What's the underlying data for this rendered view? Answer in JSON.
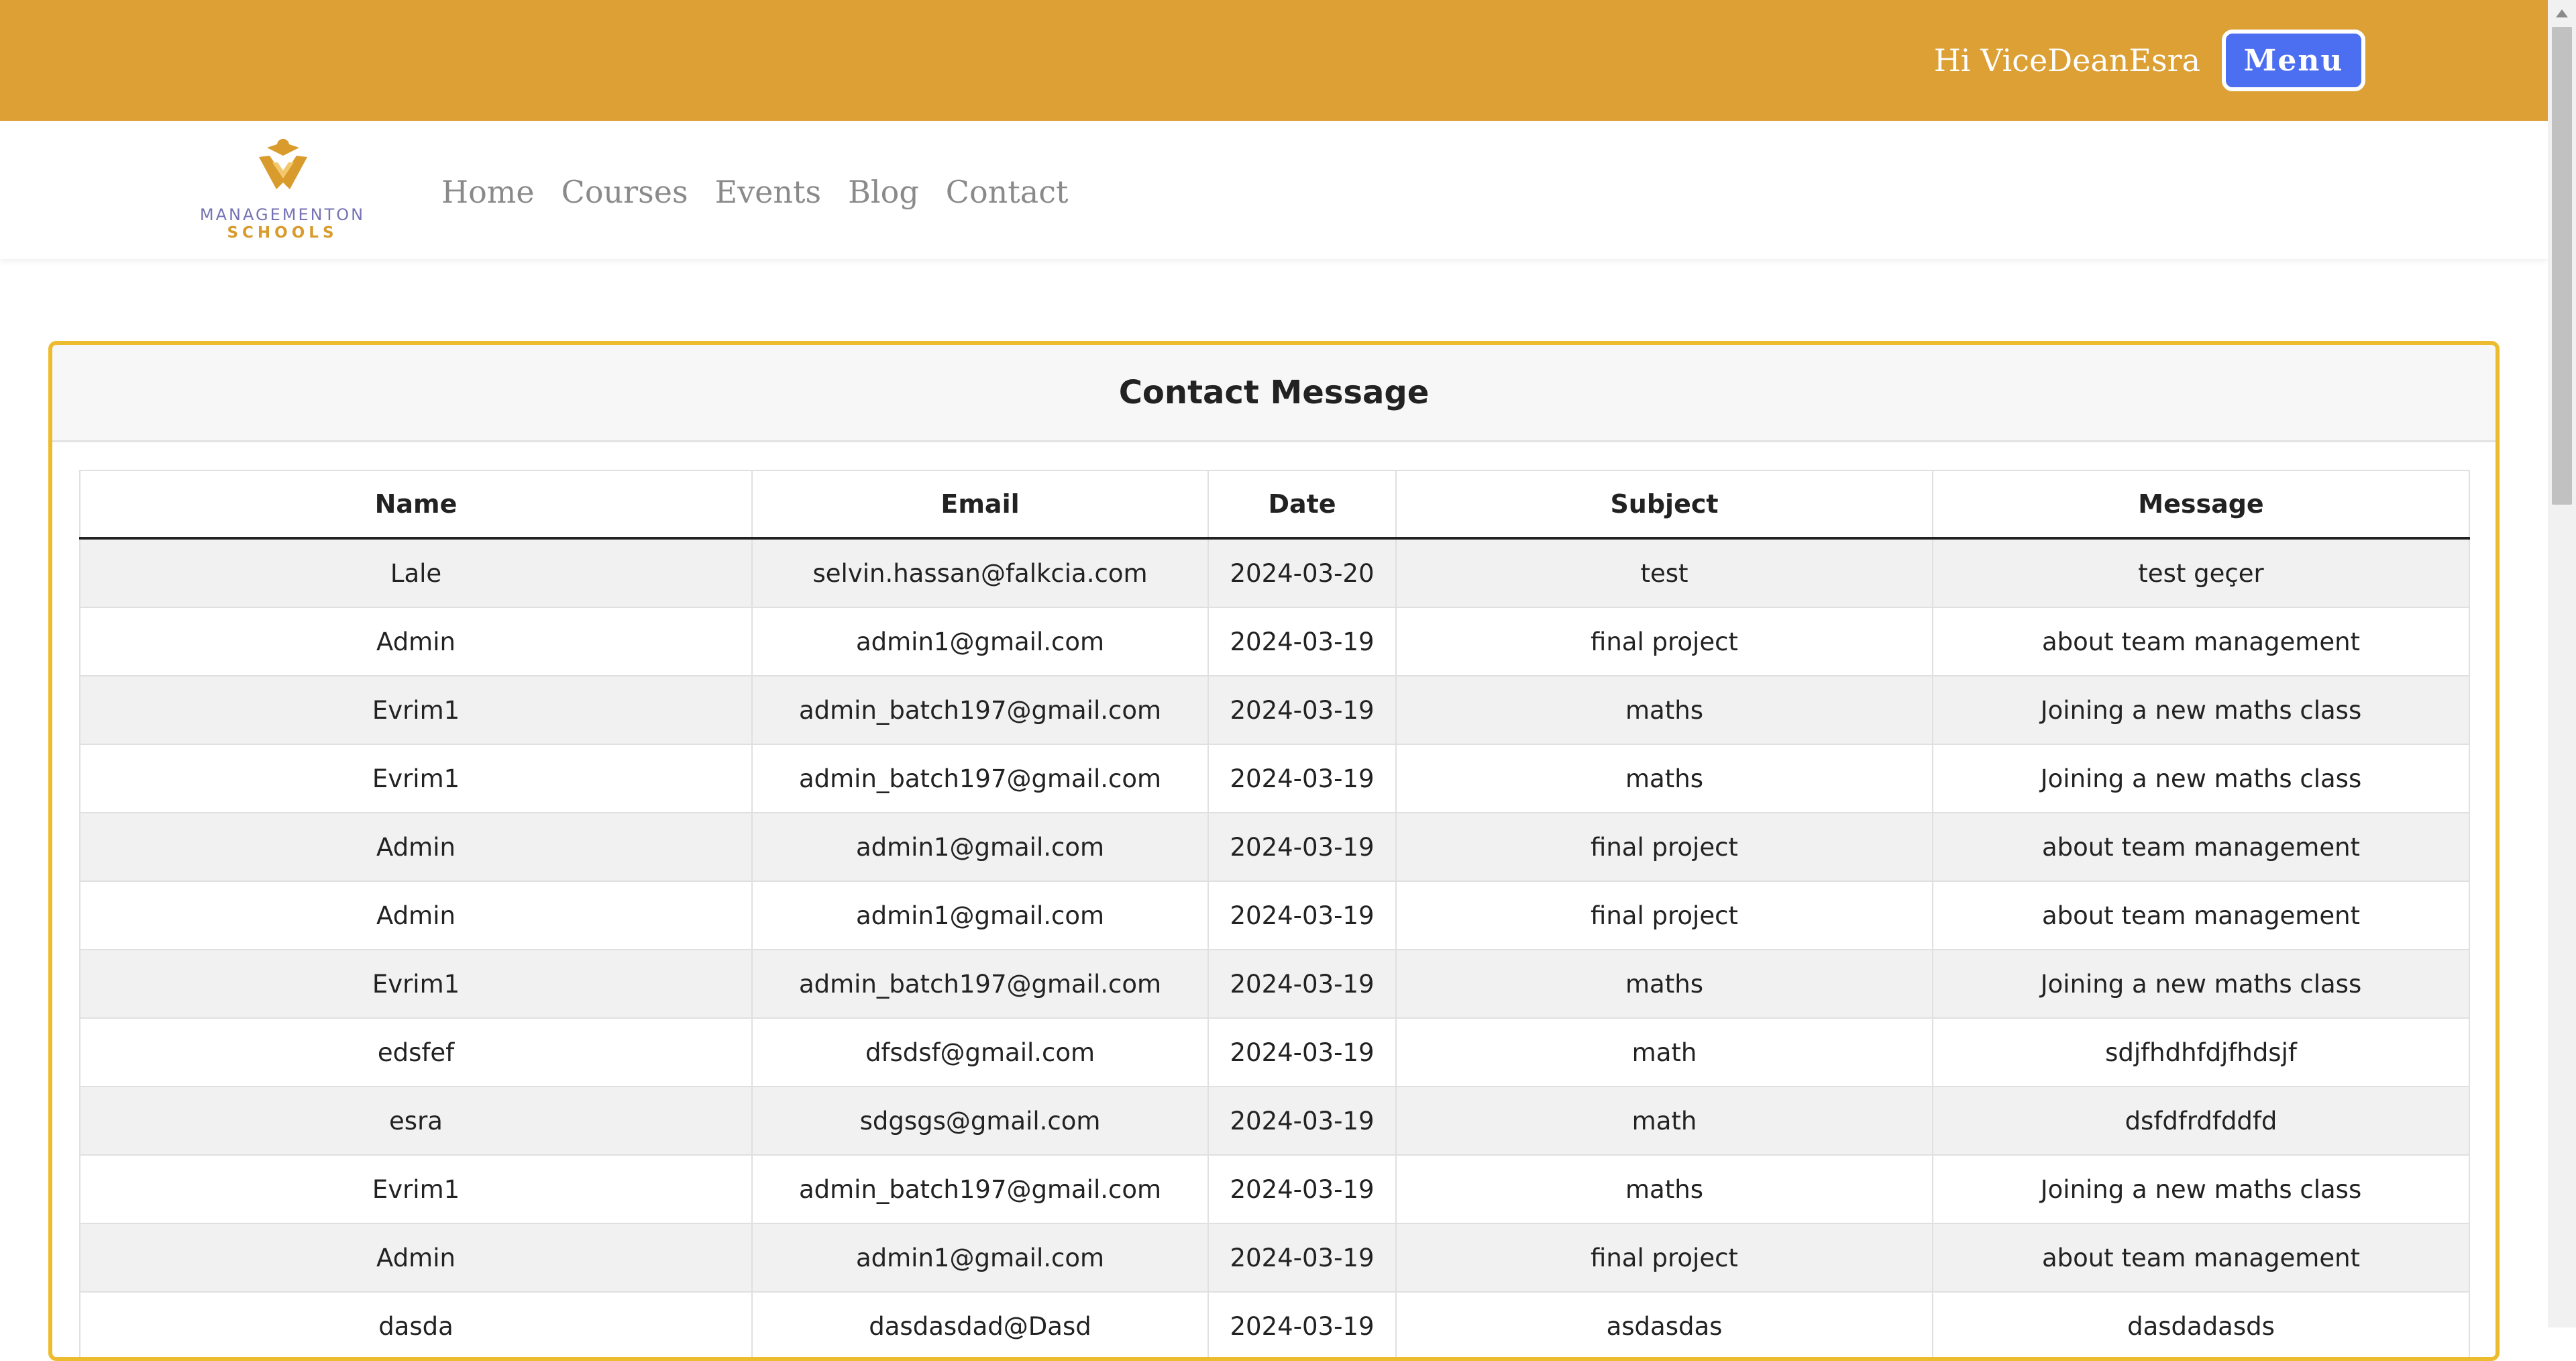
{
  "header": {
    "greeting": "Hi ViceDeanEsra",
    "menu_label": "Menu"
  },
  "brand": {
    "line1": "MANAGEMENTON",
    "line2": "SCHOOLS"
  },
  "nav": {
    "items": [
      {
        "label": "Home"
      },
      {
        "label": "Courses"
      },
      {
        "label": "Events"
      },
      {
        "label": "Blog"
      },
      {
        "label": "Contact"
      }
    ]
  },
  "card": {
    "title": "Contact Message"
  },
  "table": {
    "columns": [
      "Name",
      "Email",
      "Date",
      "Subject",
      "Message"
    ],
    "rows": [
      [
        "Lale",
        "selvin.hassan@falkcia.com",
        "2024-03-20",
        "test",
        "test geçer"
      ],
      [
        "Admin",
        "admin1@gmail.com",
        "2024-03-19",
        "final project",
        "about team management"
      ],
      [
        "Evrim1",
        "admin_batch197@gmail.com",
        "2024-03-19",
        "maths",
        "Joining a new maths class"
      ],
      [
        "Evrim1",
        "admin_batch197@gmail.com",
        "2024-03-19",
        "maths",
        "Joining a new maths class"
      ],
      [
        "Admin",
        "admin1@gmail.com",
        "2024-03-19",
        "final project",
        "about team management"
      ],
      [
        "Admin",
        "admin1@gmail.com",
        "2024-03-19",
        "final project",
        "about team management"
      ],
      [
        "Evrim1",
        "admin_batch197@gmail.com",
        "2024-03-19",
        "maths",
        "Joining a new maths class"
      ],
      [
        "edsfef",
        "dfsdsf@gmail.com",
        "2024-03-19",
        "math",
        "sdjfhdhfdjfhdsjf"
      ],
      [
        "esra",
        "sdgsgs@gmail.com",
        "2024-03-19",
        "math",
        "dsfdfrdfddfd"
      ],
      [
        "Evrim1",
        "admin_batch197@gmail.com",
        "2024-03-19",
        "maths",
        "Joining a new maths class"
      ],
      [
        "Admin",
        "admin1@gmail.com",
        "2024-03-19",
        "final project",
        "about team management"
      ],
      [
        "dasda",
        "dasdasdad@Dasd",
        "2024-03-19",
        "asdasdas",
        "dasdadasds"
      ]
    ]
  },
  "colors": {
    "topbar": "#DCA035",
    "menu_button": "#4C6EF0",
    "card_border": "#EDBC2E",
    "logo_purple": "#7673B4",
    "logo_gold": "#D89B2C"
  },
  "icons": {
    "logo": "graduation-cap-shield-icon",
    "scroll_up": "triangle-up-icon"
  }
}
